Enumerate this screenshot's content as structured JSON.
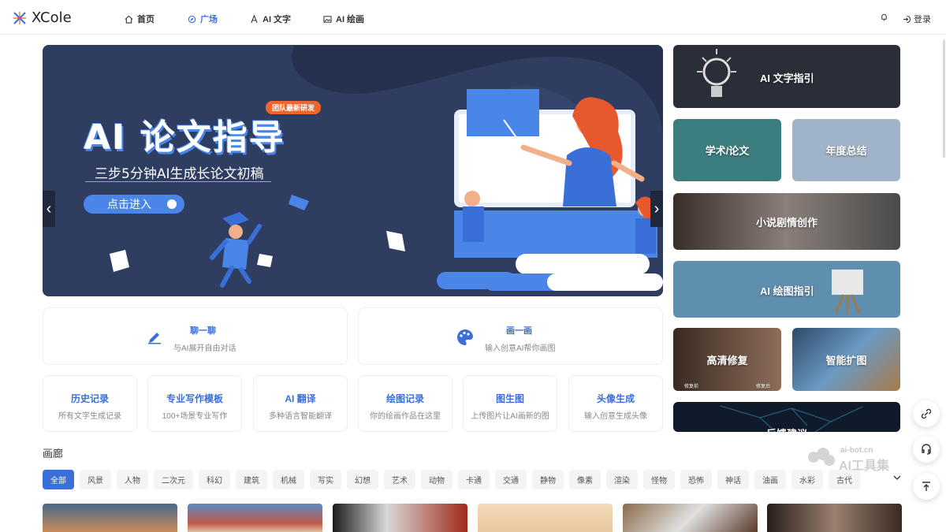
{
  "header": {
    "logo_text": "XCole",
    "nav": [
      {
        "label": "首页",
        "icon": "home-icon"
      },
      {
        "label": "广场",
        "icon": "compass-icon"
      },
      {
        "label": "AI 文字",
        "icon": "text-icon"
      },
      {
        "label": "AI 绘画",
        "icon": "image-icon"
      }
    ],
    "login_label": "登录"
  },
  "banner": {
    "badge": "团队最新研发",
    "title": "AI 论文指导",
    "subtitle": "三步5分钟AI生成长论文初稿",
    "button": "点击进入",
    "prev": "‹",
    "next": "›"
  },
  "right_cards": {
    "text_guide": "AI 文字指引",
    "academic": "学术/论文",
    "annual": "年度总结",
    "novel": "小说剧情创作",
    "draw_guide": "AI 绘图指引",
    "hd_restore": "高清修复",
    "smart_expand": "智能扩图",
    "feedback": "反馈建议",
    "hd_left_cap": "修复前",
    "hd_right_cap": "修复后"
  },
  "features_big": [
    {
      "title": "聊一聊",
      "desc": "与AI展开自由对话"
    },
    {
      "title": "画一画",
      "desc": "输入创意AI帮你画图"
    }
  ],
  "features_small": [
    {
      "title": "历史记录",
      "desc": "所有文字生成记录"
    },
    {
      "title": "专业写作模板",
      "desc": "100+场景专业写作"
    },
    {
      "title": "AI 翻译",
      "desc": "多种语言智能翻译"
    },
    {
      "title": "绘图记录",
      "desc": "你的绘画作品在这里"
    },
    {
      "title": "图生图",
      "desc": "上传图片让AI画新的图"
    },
    {
      "title": "头像生成",
      "desc": "输入创意生成头像"
    }
  ],
  "gallery": {
    "title": "画廊",
    "tags": [
      "全部",
      "风景",
      "人物",
      "二次元",
      "科幻",
      "建筑",
      "机械",
      "写实",
      "幻想",
      "艺术",
      "动物",
      "卡通",
      "交通",
      "静物",
      "像素",
      "渲染",
      "怪物",
      "恐怖",
      "神话",
      "油画",
      "水彩",
      "古代"
    ],
    "active_tag": "全部"
  },
  "watermark": {
    "small": "ai-bot.cn",
    "big": "AI工具集"
  },
  "colors": {
    "accent": "#3a6fd8",
    "banner_bg": "#2c3a5c",
    "badge": "#f0652b"
  }
}
